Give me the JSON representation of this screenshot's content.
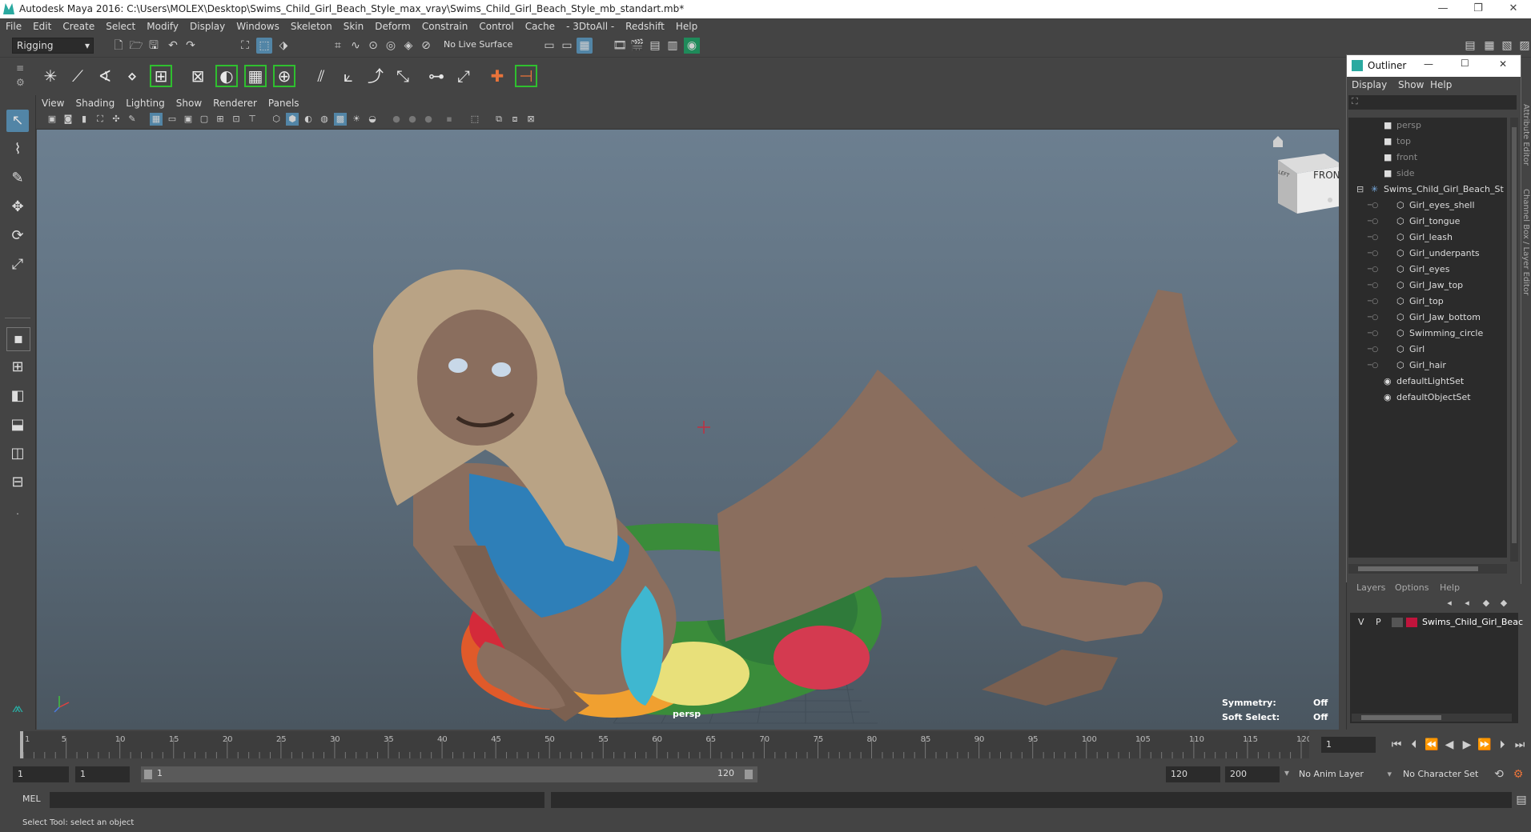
{
  "window": {
    "title": "Autodesk Maya 2016: C:\\Users\\MOLEX\\Desktop\\Swims_Child_Girl_Beach_Style_max_vray\\Swims_Child_Girl_Beach_Style_mb_standart.mb*",
    "minimize": "—",
    "maximize": "❐",
    "close": "✕"
  },
  "menus": [
    "File",
    "Edit",
    "Create",
    "Select",
    "Modify",
    "Display",
    "Windows",
    "Skeleton",
    "Skin",
    "Deform",
    "Constrain",
    "Control",
    "Cache",
    "- 3DtoAll -",
    "Redshift",
    "Help"
  ],
  "status": {
    "mode": "Rigging",
    "live_surface": "No Live Surface"
  },
  "panel_menus": [
    "View",
    "Shading",
    "Lighting",
    "Show",
    "Renderer",
    "Panels"
  ],
  "viewport": {
    "camera_label": "persp",
    "viewcube_front": "FRONT",
    "viewcube_left": "LEFT",
    "symmetry_label": "Symmetry:",
    "symmetry_value": "Off",
    "soft_select_label": "Soft Select:",
    "soft_select_value": "Off"
  },
  "outliner": {
    "title": "Outliner",
    "menus": [
      "Display",
      "Show",
      "Help"
    ],
    "items": [
      {
        "label": "persp",
        "icon": "camera-icon",
        "dim": true,
        "indent": 1
      },
      {
        "label": "top",
        "icon": "camera-icon",
        "dim": true,
        "indent": 1
      },
      {
        "label": "front",
        "icon": "camera-icon",
        "dim": true,
        "indent": 1
      },
      {
        "label": "side",
        "icon": "camera-icon",
        "dim": true,
        "indent": 1
      },
      {
        "label": "Swims_Child_Girl_Beach_St",
        "icon": "joint-icon",
        "dim": false,
        "indent": 0
      },
      {
        "label": "Girl_eyes_shell",
        "icon": "mesh-icon",
        "dim": false,
        "indent": 2
      },
      {
        "label": "Girl_tongue",
        "icon": "mesh-icon",
        "dim": false,
        "indent": 2
      },
      {
        "label": "Girl_leash",
        "icon": "mesh-icon",
        "dim": false,
        "indent": 2
      },
      {
        "label": "Girl_underpants",
        "icon": "mesh-icon",
        "dim": false,
        "indent": 2
      },
      {
        "label": "Girl_eyes",
        "icon": "mesh-icon",
        "dim": false,
        "indent": 2
      },
      {
        "label": "Girl_Jaw_top",
        "icon": "mesh-icon",
        "dim": false,
        "indent": 2
      },
      {
        "label": "Girl_top",
        "icon": "mesh-icon",
        "dim": false,
        "indent": 2
      },
      {
        "label": "Girl_Jaw_bottom",
        "icon": "mesh-icon",
        "dim": false,
        "indent": 2
      },
      {
        "label": "Swimming_circle",
        "icon": "mesh-icon",
        "dim": false,
        "indent": 2
      },
      {
        "label": "Girl",
        "icon": "mesh-icon",
        "dim": false,
        "indent": 2
      },
      {
        "label": "Girl_hair",
        "icon": "mesh-icon",
        "dim": false,
        "indent": 2
      },
      {
        "label": "defaultLightSet",
        "icon": "set-icon",
        "dim": false,
        "indent": 1
      },
      {
        "label": "defaultObjectSet",
        "icon": "set-icon",
        "dim": false,
        "indent": 1
      }
    ]
  },
  "side_tabs": {
    "attribute_editor": "Attribute Editor",
    "channel_box": "Channel Box / Layer Editor"
  },
  "layers": {
    "menus": [
      "Layers",
      "Options",
      "Help"
    ],
    "row": {
      "v": "V",
      "p": "P",
      "name": "Swims_Child_Girl_Beac",
      "color": "#c0143c"
    }
  },
  "timeline": {
    "ticks": [
      1,
      5,
      10,
      15,
      20,
      25,
      30,
      35,
      40,
      45,
      50,
      55,
      60,
      65,
      70,
      75,
      80,
      85,
      90,
      95,
      100,
      105,
      110,
      115,
      120
    ],
    "current_frame": "1"
  },
  "range": {
    "start": "1",
    "playback_start": "1",
    "slider_start": "1",
    "slider_end": "120",
    "playback_end": "120",
    "end": "200",
    "anim_layer": "No Anim Layer",
    "character_set": "No Character Set"
  },
  "command": {
    "lang": "MEL"
  },
  "help_line": "Select Tool: select an object",
  "colors": {
    "accent": "#5285a6",
    "shelf_highlight": "#2fbf2f",
    "maya_teal": "#2aa9a0"
  }
}
